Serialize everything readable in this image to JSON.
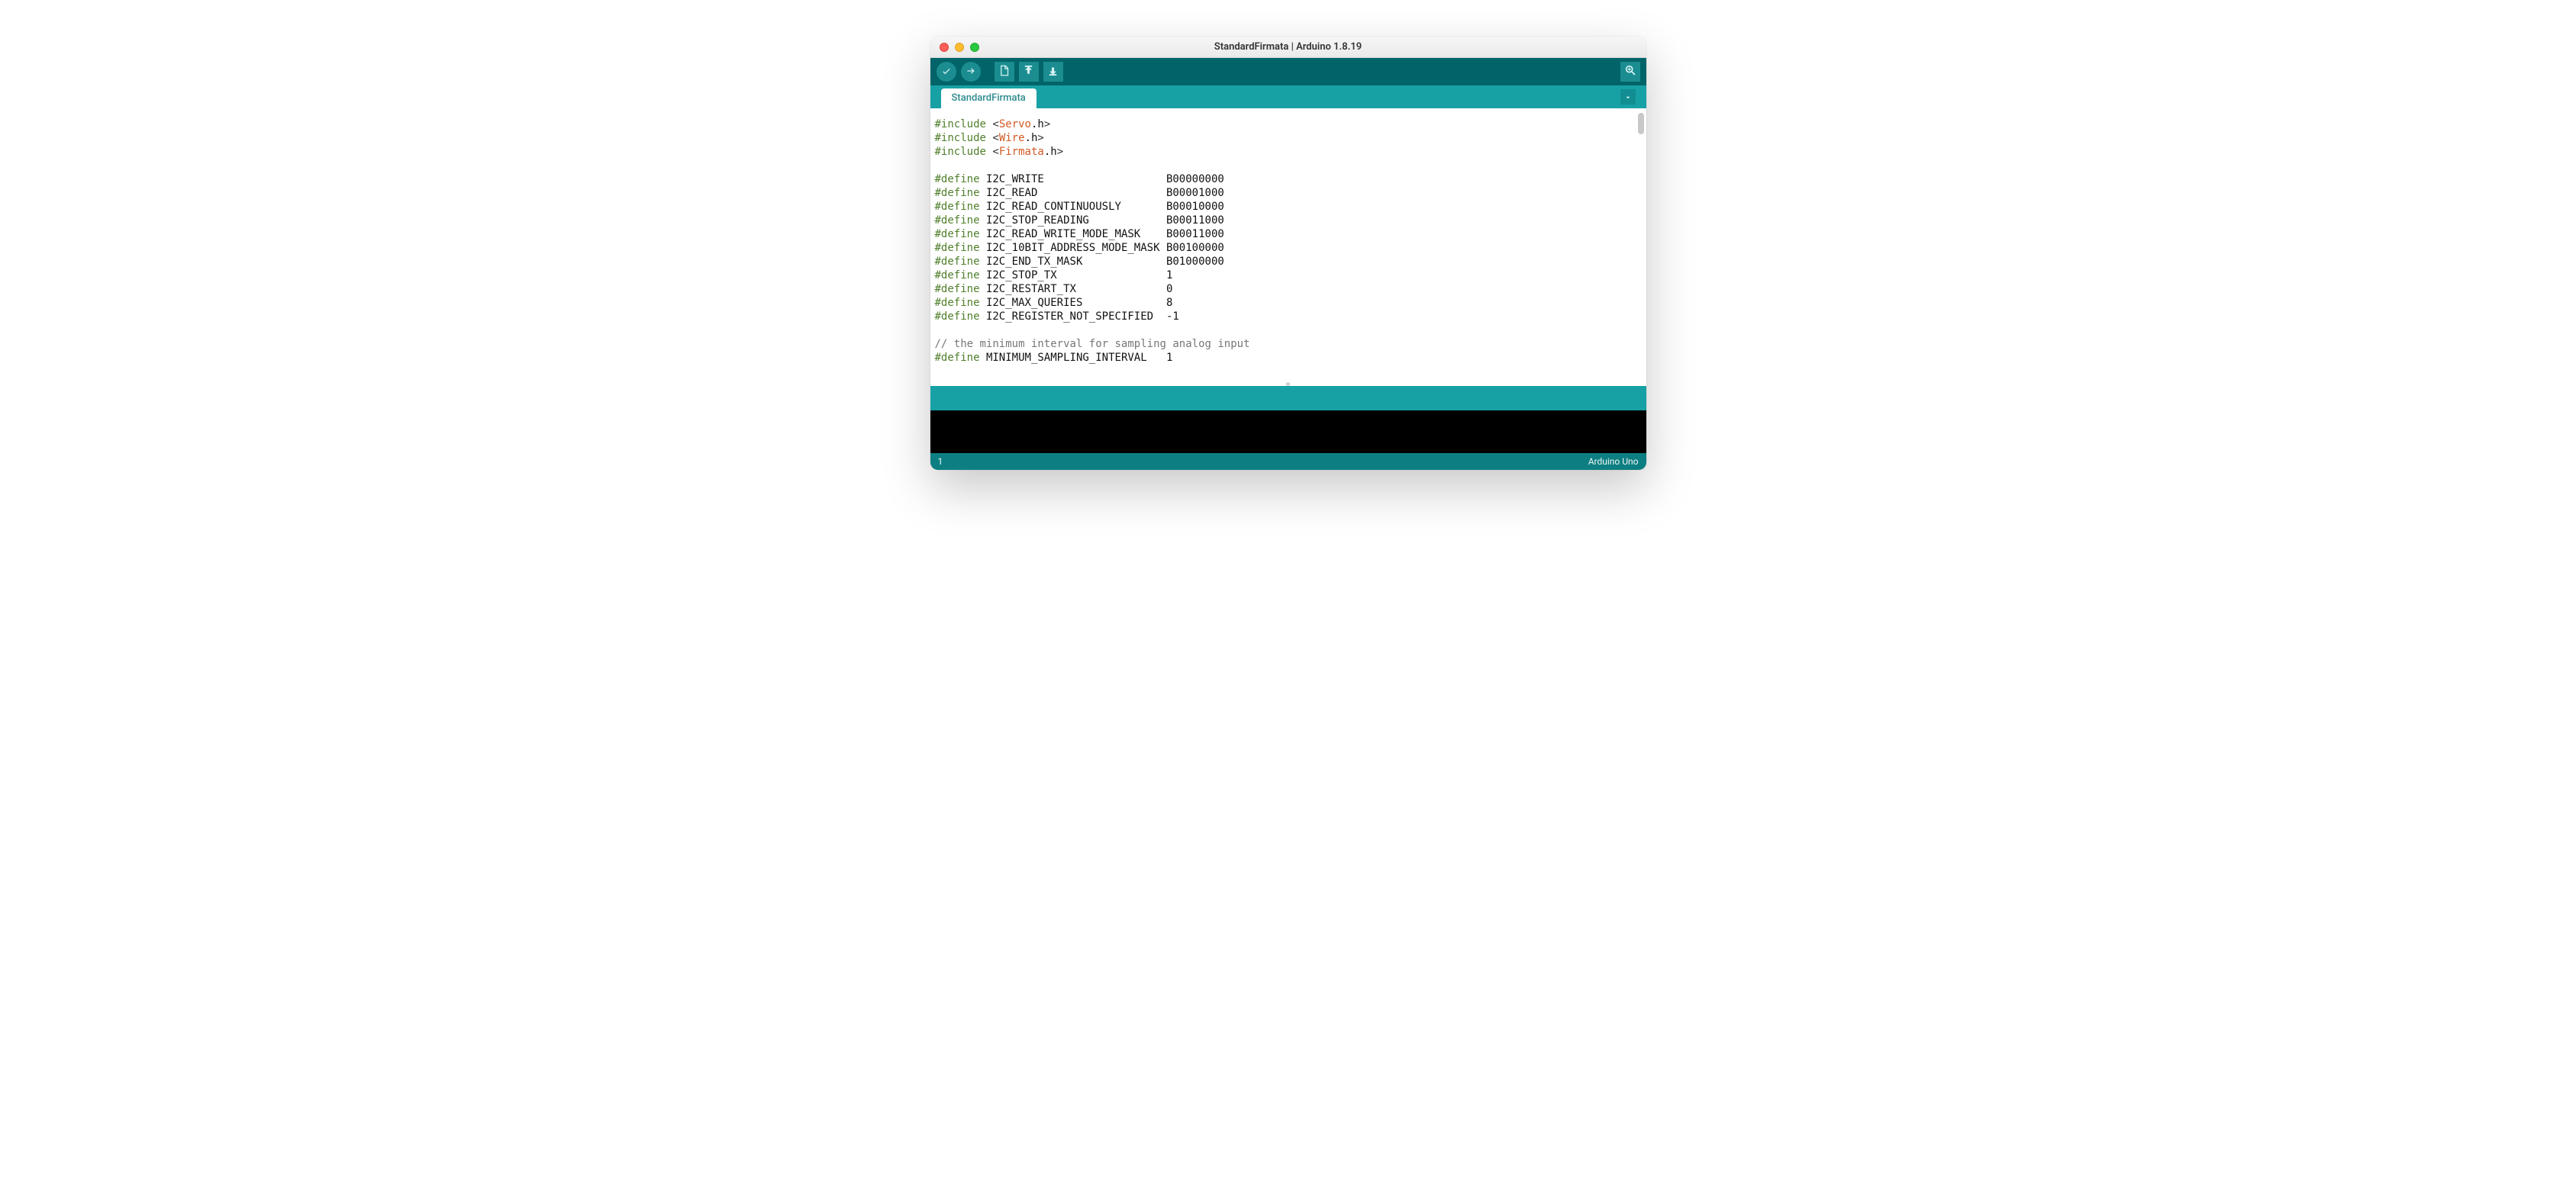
{
  "window": {
    "title": "StandardFirmata | Arduino 1.8.19"
  },
  "toolbar": {
    "verify": "Verify",
    "upload": "Upload",
    "new": "New",
    "open": "Open",
    "save": "Save",
    "serial_monitor": "Serial Monitor"
  },
  "tabs": {
    "active": "StandardFirmata",
    "dropdown": "Tab menu"
  },
  "code": {
    "tokens": [
      [
        [
          "prep",
          "#include"
        ],
        [
          "txt",
          " "
        ],
        [
          "op",
          "<"
        ],
        [
          "hdr",
          "Servo"
        ],
        [
          "txt",
          ".h"
        ],
        [
          "op",
          ">"
        ]
      ],
      [
        [
          "prep",
          "#include"
        ],
        [
          "txt",
          " "
        ],
        [
          "op",
          "<"
        ],
        [
          "hdr",
          "Wire"
        ],
        [
          "txt",
          ".h"
        ],
        [
          "op",
          ">"
        ]
      ],
      [
        [
          "prep",
          "#include"
        ],
        [
          "txt",
          " "
        ],
        [
          "op",
          "<"
        ],
        [
          "hdr",
          "Firmata"
        ],
        [
          "txt",
          ".h"
        ],
        [
          "op",
          ">"
        ]
      ],
      [],
      [
        [
          "prep",
          "#define"
        ],
        [
          "txt",
          " I2C_WRITE                   B00000000"
        ]
      ],
      [
        [
          "prep",
          "#define"
        ],
        [
          "txt",
          " I2C_READ                    B00001000"
        ]
      ],
      [
        [
          "prep",
          "#define"
        ],
        [
          "txt",
          " I2C_READ_CONTINUOUSLY       B00010000"
        ]
      ],
      [
        [
          "prep",
          "#define"
        ],
        [
          "txt",
          " I2C_STOP_READING            B00011000"
        ]
      ],
      [
        [
          "prep",
          "#define"
        ],
        [
          "txt",
          " I2C_READ_WRITE_MODE_MASK    B00011000"
        ]
      ],
      [
        [
          "prep",
          "#define"
        ],
        [
          "txt",
          " I2C_10BIT_ADDRESS_MODE_MASK B00100000"
        ]
      ],
      [
        [
          "prep",
          "#define"
        ],
        [
          "txt",
          " I2C_END_TX_MASK             B01000000"
        ]
      ],
      [
        [
          "prep",
          "#define"
        ],
        [
          "txt",
          " I2C_STOP_TX                 1"
        ]
      ],
      [
        [
          "prep",
          "#define"
        ],
        [
          "txt",
          " I2C_RESTART_TX              0"
        ]
      ],
      [
        [
          "prep",
          "#define"
        ],
        [
          "txt",
          " I2C_MAX_QUERIES             8"
        ]
      ],
      [
        [
          "prep",
          "#define"
        ],
        [
          "txt",
          " I2C_REGISTER_NOT_SPECIFIED  -1"
        ]
      ],
      [],
      [
        [
          "comment",
          "// the minimum interval for sampling analog input"
        ]
      ],
      [
        [
          "prep",
          "#define"
        ],
        [
          "txt",
          " MINIMUM_SAMPLING_INTERVAL   1"
        ]
      ]
    ]
  },
  "status": {
    "line": "1",
    "board": "Arduino Uno"
  }
}
